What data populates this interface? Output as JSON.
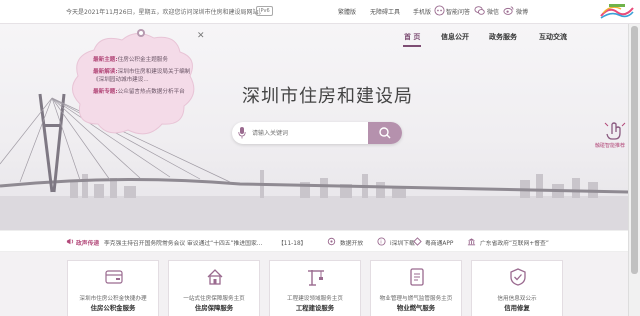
{
  "topbar": {
    "welcome": "今天是2021年11月26日，星期五，欢迎您访问深圳市住房和建设局网站。",
    "ipv6_badge": "IPv6",
    "links": [
      {
        "label": "繁體版"
      },
      {
        "label": "无障碍工具"
      },
      {
        "label": "手机版"
      },
      {
        "label": "智能问答"
      },
      {
        "label": "微信"
      },
      {
        "label": "微博"
      }
    ]
  },
  "nav": {
    "items": [
      "首 页",
      "信息公开",
      "政务服务",
      "互动交流"
    ],
    "active_color": "#7d4d73"
  },
  "cloud": {
    "items": [
      {
        "tag": "最新主题:",
        "text": "住房公积金主题服务"
      },
      {
        "tag": "最新解读:",
        "text": "深圳市住房和建设局关于编制《深圳园动城市建设..."
      },
      {
        "tag": "最新专题:",
        "text": "公众留言热点数据分析平台"
      }
    ]
  },
  "hero": {
    "title": "深圳市住房和建设局",
    "search_placeholder": "请输入关键词"
  },
  "smart_recommend": {
    "label": "触碰智能推荐"
  },
  "newsbar": {
    "section": "政声传递",
    "headline": "李克强主持召开国务院常务会议 审议通过“十四五”推进国家...",
    "date": "【11-18】",
    "links": [
      "数据开放",
      "i深圳下载",
      "粤商通APP",
      "广东省政府“互联网+督查”"
    ]
  },
  "cards": [
    {
      "line1": "深圳市住房公积金快捷办理",
      "line2": "住房公积金服务"
    },
    {
      "line1": "一站式住房保障服务主页",
      "line2": "住房保障服务"
    },
    {
      "line1": "工程建设领域服务主页",
      "line2": "工程建设服务"
    },
    {
      "line1": "物业管理与燃气监管服务主页",
      "line2": "物业燃气服务"
    },
    {
      "line1": "信用信息双公示",
      "line2": "信用修复"
    }
  ],
  "colors": {
    "brand": "#7d4d73",
    "accent": "#b34a7a",
    "search_button": "#b591ad"
  }
}
